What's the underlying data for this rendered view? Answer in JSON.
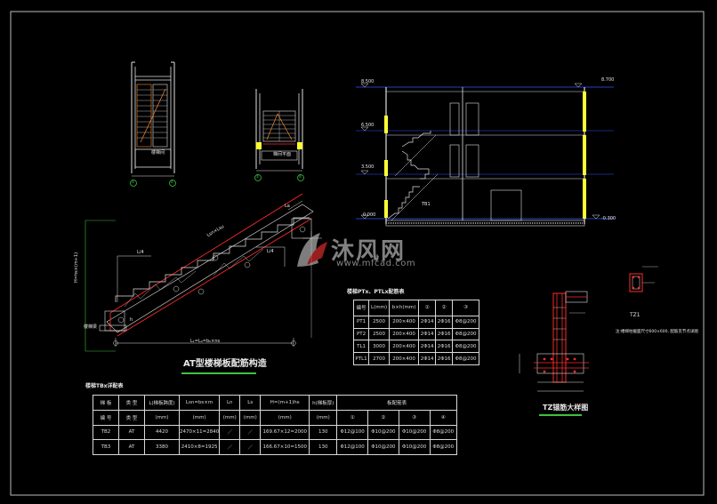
{
  "drawings": {
    "stair_detail_title": "AT型楼梯板配筋构造",
    "table_title": "楼梯TBx详配表",
    "tz_detail_title": "TZ锚筋大样图",
    "tz1_label": "TZ1",
    "tz1_note": "注:楼梯柱截面尺寸600×600, 配筋见节点详图",
    "ptz_table_title": "楼梯PTx、PTLx配筋表",
    "stair_slope_dim": "Lsn×Lsu",
    "stair_dim_bottom": "L₁=L₀=b₀×ns",
    "label_h": "H=hs×(m+1)",
    "label_ls4": "L/4",
    "label_hb": "h",
    "label_beam": "楼梯梁",
    "label_ln": "La"
  },
  "section": {
    "elev_top": "8.700",
    "elev_top_left": "8.500",
    "elev_2": "6.500",
    "elev_1": "3.500",
    "elev_0": "0.000",
    "elev_neg": "-0.300",
    "label_stair": "TB1"
  },
  "plan": {
    "left_label_bottom": "楼梯间",
    "right_label_bottom": "梯间平面",
    "axis_a": "①",
    "axis_b": "②",
    "axis_c": "①",
    "axis_d": "②"
  },
  "main_table": {
    "headers_row1": [
      "梯 板",
      "类 型",
      "L(梯板跨度)",
      "Lsn=bs×m",
      "Ln",
      "Ls",
      "H=(m+1)hs",
      "h(梯板厚)",
      "板配筋表"
    ],
    "headers_row2": [
      "编 号",
      "类 型",
      "(mm)",
      "(mm)",
      "(mm)",
      "(mm)",
      "(mm)",
      "(mm)"
    ],
    "rebar_headers": [
      "①",
      "②",
      "③",
      "④"
    ],
    "rows": [
      [
        "TB2",
        "AT",
        "4420",
        "2470×11=2840",
        "／",
        "／",
        "169.67×12=2000",
        "130",
        "Φ12@100",
        "Φ10@200",
        "Φ10@200",
        "Φ8@200"
      ],
      [
        "TB3",
        "AT",
        "3380",
        "2410×8=1925",
        "／",
        "／",
        "166.67×10=1500",
        "130",
        "Φ12@100",
        "Φ10@200",
        "Φ10@200",
        "Φ8@200"
      ]
    ]
  },
  "ptz_table": {
    "headers": [
      "编号",
      "L(mm)",
      "b×h(mm)",
      "①",
      "②",
      "③"
    ],
    "rows": [
      [
        "PT1",
        "2500",
        "200×400",
        "2Φ14",
        "2Φ16",
        "Φ8@200"
      ],
      [
        "PT2",
        "2500",
        "200×400",
        "2Φ14",
        "2Φ16",
        "Φ8@200"
      ],
      [
        "TL1",
        "3000",
        "200×400",
        "2Φ14",
        "2Φ16",
        "Φ8@200"
      ],
      [
        "PTL1",
        "2700",
        "200×400",
        "2Φ14",
        "2Φ16",
        "Φ8@200"
      ]
    ]
  },
  "watermark": {
    "brand": "沐风网",
    "url": "www.mfcad.com"
  },
  "colors": {
    "background": "#000000",
    "red": "#ff2a2a",
    "green": "#3ec23e",
    "yellow": "#ffff33",
    "cyan": "#00e5ff",
    "blue": "#3355ff",
    "line": "#e8e8e8"
  }
}
